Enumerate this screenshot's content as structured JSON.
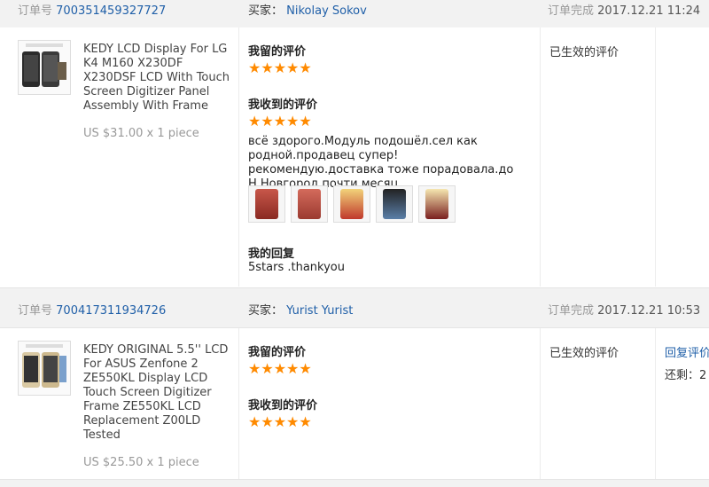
{
  "orders": [
    {
      "order_no_label": "订单号",
      "order_no": "700351459327727",
      "buyer_label": "买家：",
      "buyer_name": "Nikolay Sokov",
      "completed_label": "订单完成",
      "completed_time": "2017.12.21 11:24",
      "thumb_caption": "For LG K4 LCD",
      "product_title": "KEDY LCD Display For LG K4 M160 X230DF X230DSF LCD With Touch Screen Digitizer Panel Assembly With Frame",
      "price": "US $31.00 x 1 piece",
      "my_review_label": "我留的评价",
      "my_stars": "★★★★★",
      "received_review_label": "我收到的评价",
      "received_stars": "★★★★★",
      "review_text": "всё здорого.Модуль подошёл.сел как родной.продавец супер!рекомендую.доставка тоже порадовала.до Н.Новгород почти месяц.",
      "reply_label": "我的回复",
      "reply_text": "5stars .thankyou",
      "status": "已生效的评价"
    },
    {
      "order_no_label": "订单号",
      "order_no": "700417311934726",
      "buyer_label": "买家：",
      "buyer_name": "Yurist Yurist",
      "completed_label": "订单完成",
      "completed_time": "2017.12.21 10:53",
      "thumb_caption": "For Asus ZE550KL",
      "product_title": "KEDY ORIGINAL 5.5'' LCD For ASUS Zenfone 2 ZE550KL Display LCD Touch Screen Digitizer Frame ZE550KL LCD Replacement Z00LD Tested",
      "price": "US $25.50 x 1 piece",
      "my_review_label": "我留的评价",
      "my_stars": "★★★★★",
      "received_review_label": "我收到的评价",
      "received_stars": "★★★★★",
      "status": "已生效的评价",
      "reply_action": "回复评价",
      "remain_label": "还剩：",
      "remain_value": "2"
    }
  ],
  "photo_icons": [
    "phone-photo-icon",
    "phone-photo-icon",
    "phone-photo-icon",
    "phone-photo-icon",
    "phone-photo-icon"
  ],
  "colors": {
    "link": "#1f5fa8",
    "star": "#ff8a00",
    "header_bg": "#f2f2f2"
  }
}
